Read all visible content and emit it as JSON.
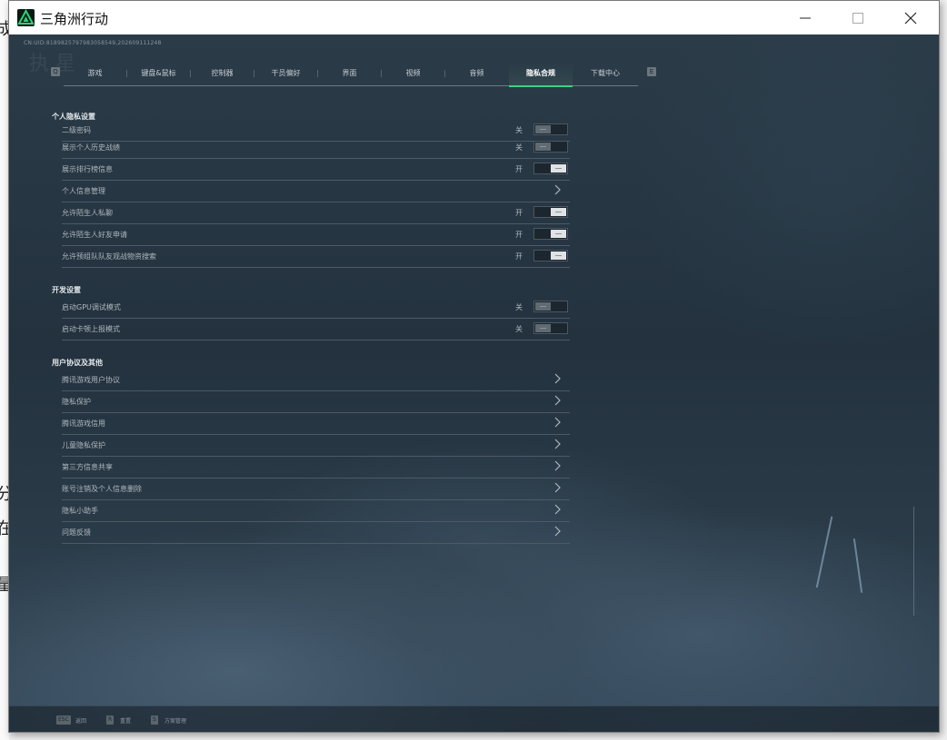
{
  "window": {
    "title": "三角洲行动"
  },
  "background_glyphs": [
    "成",
    "分",
    "在",
    "量"
  ],
  "game": {
    "uid": "CN:UID:8189825797983058549,202609111248",
    "header_faint": "执 星",
    "tabs": [
      {
        "label": "游戏",
        "active": false
      },
      {
        "label": "键盘&鼠标",
        "active": false
      },
      {
        "label": "控制器",
        "active": false
      },
      {
        "label": "干员偏好",
        "active": false
      },
      {
        "label": "界面",
        "active": false
      },
      {
        "label": "视频",
        "active": false
      },
      {
        "label": "音频",
        "active": false
      },
      {
        "label": "隐私合规",
        "active": true
      },
      {
        "label": "下载中心",
        "active": false
      }
    ],
    "tab_key_left": "Q",
    "tab_key_right": "E",
    "sections": {
      "personal": {
        "title": "个人隐私设置",
        "rows": [
          {
            "label": "二级密码",
            "state": "关",
            "type": "toggle-off"
          },
          {
            "label": "展示个人历史战绩",
            "state": "关",
            "type": "toggle-off"
          },
          {
            "label": "展示排行榜信息",
            "state": "开",
            "type": "toggle-on"
          },
          {
            "label": "个人信息管理",
            "state": "",
            "type": "link"
          },
          {
            "label": "允许陌生人私聊",
            "state": "开",
            "type": "toggle-on"
          },
          {
            "label": "允许陌生人好友申请",
            "state": "开",
            "type": "toggle-on"
          },
          {
            "label": "允许预组队队友观战物资搜索",
            "state": "开",
            "type": "toggle-on"
          }
        ]
      },
      "dev": {
        "title": "开发设置",
        "rows": [
          {
            "label": "启动GPU调试模式",
            "state": "关",
            "type": "toggle-off"
          },
          {
            "label": "启动卡顿上报模式",
            "state": "关",
            "type": "toggle-off"
          }
        ]
      },
      "agreements": {
        "title": "用户协议及其他",
        "rows": [
          {
            "label": "腾讯游戏用户协议",
            "state": "",
            "type": "link"
          },
          {
            "label": "隐私保护",
            "state": "",
            "type": "link"
          },
          {
            "label": "腾讯游戏信用",
            "state": "",
            "type": "link"
          },
          {
            "label": "儿童隐私保护",
            "state": "",
            "type": "link"
          },
          {
            "label": "第三方信息共享",
            "state": "",
            "type": "link"
          },
          {
            "label": "账号注销及个人信息删除",
            "state": "",
            "type": "link"
          },
          {
            "label": "隐私小助手",
            "state": "",
            "type": "link"
          },
          {
            "label": "问题反馈",
            "state": "",
            "type": "link"
          }
        ]
      }
    },
    "bottom_bar": [
      {
        "key": "ESC",
        "label": "返回"
      },
      {
        "key": "R",
        "label": "重置"
      },
      {
        "key": "S",
        "label": "方案管理"
      }
    ]
  },
  "colors": {
    "accent": "#3fd17f",
    "toggle_on": "#dfe3e6",
    "toggle_off": "#5f6a73",
    "panel_bg": "#23323e"
  },
  "icons": {
    "app": "delta-force-logo-icon",
    "minimize": "minimize-icon",
    "maximize": "maximize-icon",
    "close": "close-icon",
    "chevron": "chevron-right-icon"
  }
}
